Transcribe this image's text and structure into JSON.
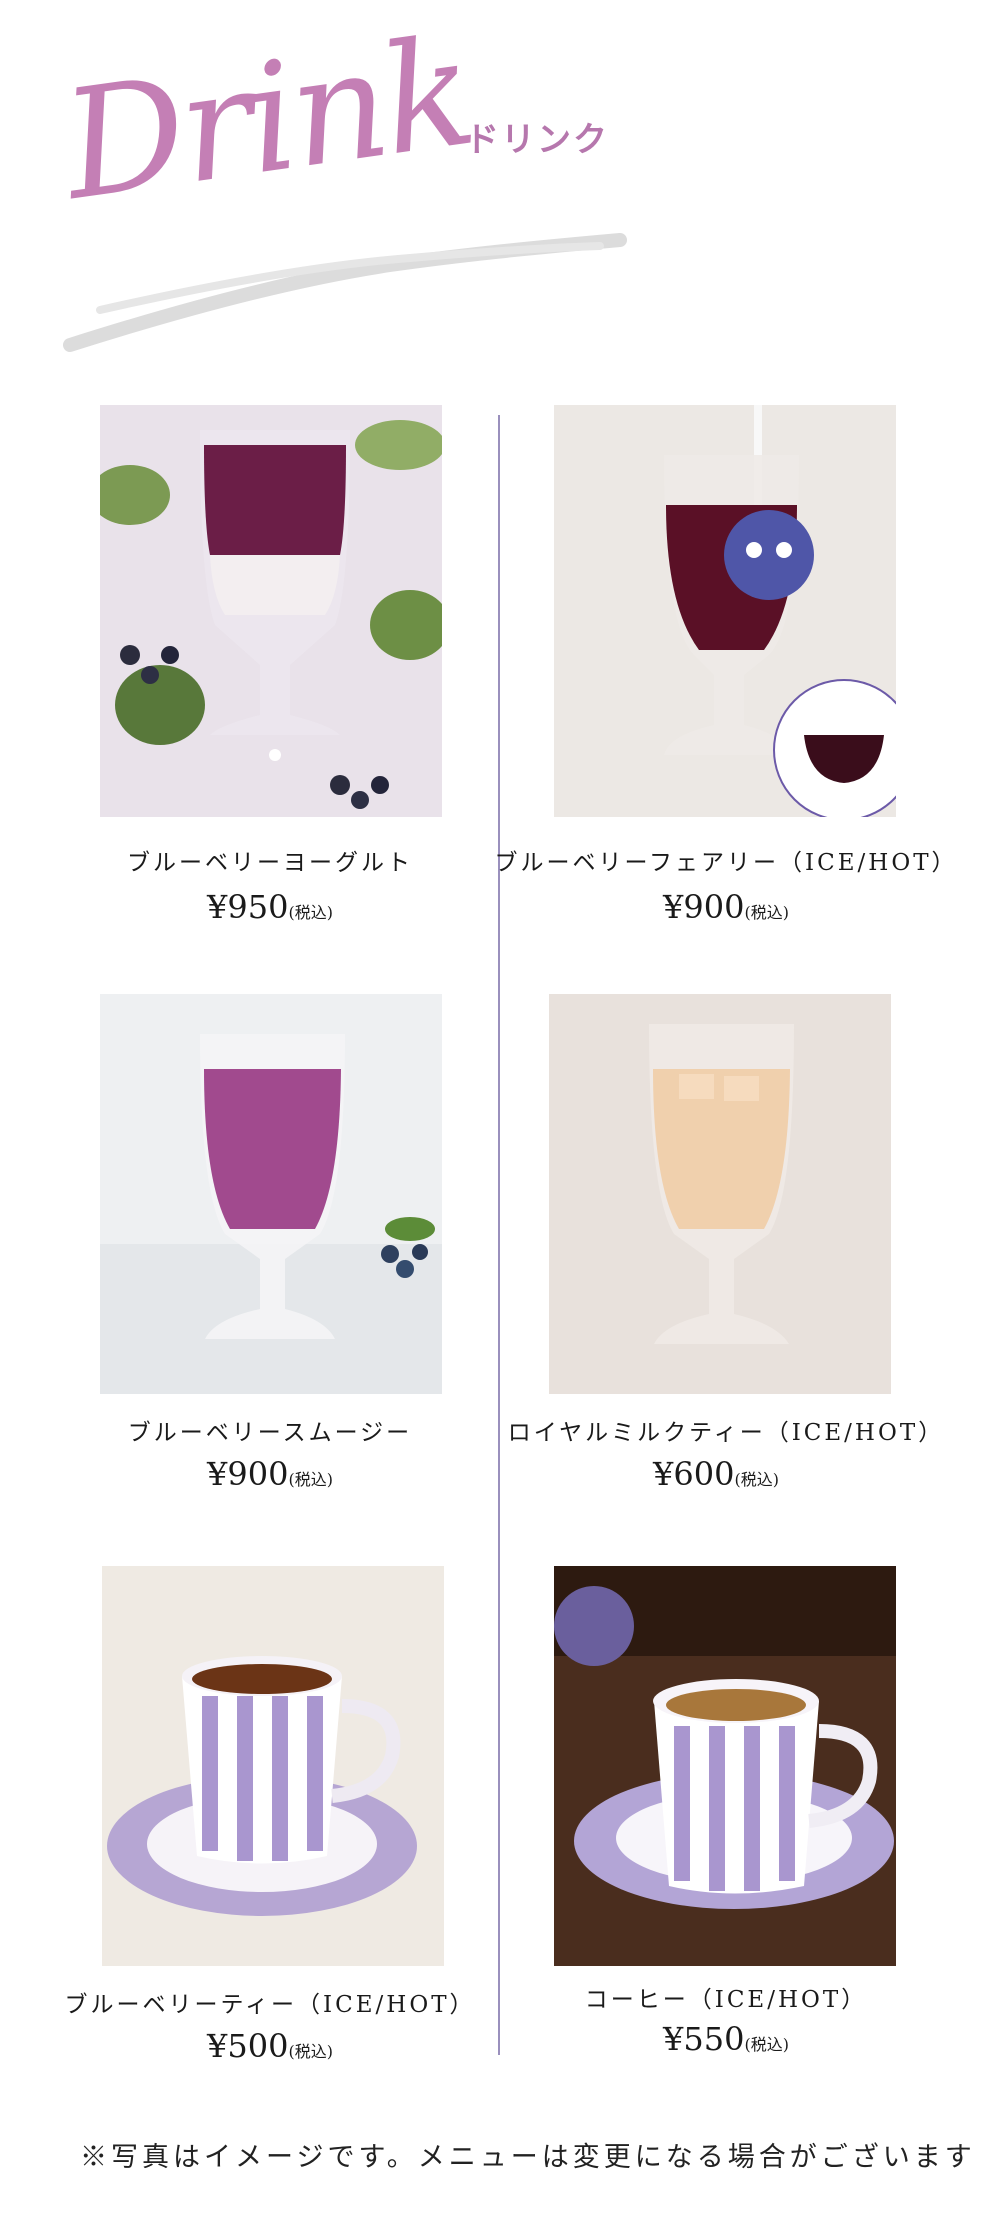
{
  "header": {
    "script_title": "Drink",
    "subtitle": "ドリンク"
  },
  "colors": {
    "accent_pink": "#c47fb5",
    "divider": "#9a90bd"
  },
  "items": [
    {
      "name": "ブルーベリーヨーグルト",
      "price": "¥950",
      "tax_note": "(税込)",
      "photo_icon": "blueberry-yogurt-photo"
    },
    {
      "name": "ブルーベリーフェアリー（ICE/HOT）",
      "price": "¥900",
      "tax_note": "(税込)",
      "photo_icon": "blueberry-fairy-photo"
    },
    {
      "name": "ブルーベリースムージー",
      "price": "¥900",
      "tax_note": "(税込)",
      "photo_icon": "blueberry-smoothie-photo"
    },
    {
      "name": "ロイヤルミルクティー（ICE/HOT）",
      "price": "¥600",
      "tax_note": "(税込)",
      "photo_icon": "royal-milk-tea-photo"
    },
    {
      "name": "ブルーベリーティー（ICE/HOT）",
      "price": "¥500",
      "tax_note": "(税込)",
      "photo_icon": "blueberry-tea-photo"
    },
    {
      "name": "コーヒー（ICE/HOT）",
      "price": "¥550",
      "tax_note": "(税込)",
      "photo_icon": "coffee-photo"
    }
  ],
  "footnote": "※写真はイメージです。メニューは変更になる場合がございます"
}
